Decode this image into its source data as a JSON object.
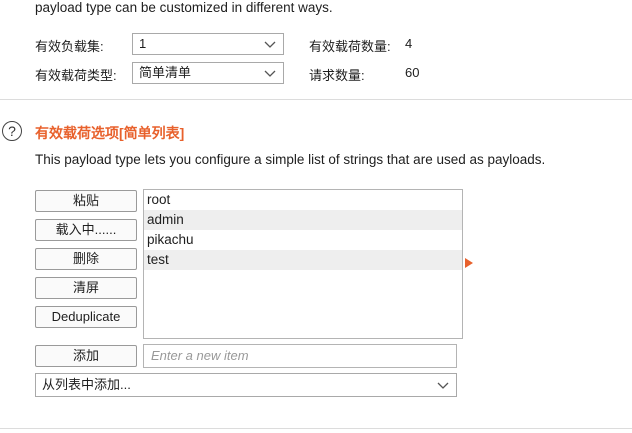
{
  "intro_text": "payload type can be customized in different ways.",
  "payload_sets": {
    "payload_set_label": "有效负载集:",
    "payload_set_value": "1",
    "payload_count_label": "有效载荷数量:",
    "payload_count_value": "4",
    "payload_type_label": "有效载荷类型:",
    "payload_type_value": "简单清单",
    "request_count_label": "请求数量:",
    "request_count_value": "60"
  },
  "options": {
    "help_glyph": "?",
    "title": "有效载荷选项[简单列表]",
    "description": "This payload type lets you configure a simple list of strings that are used as payloads.",
    "buttons": {
      "paste": "粘贴",
      "load": "载入中......",
      "remove": "删除",
      "clear": "清屏",
      "deduplicate": "Deduplicate",
      "add": "添加"
    },
    "items": [
      "root",
      "admin",
      "pikachu",
      "test"
    ],
    "add_placeholder": "Enter a new item",
    "add_from_list": "从列表中添加..."
  },
  "colors": {
    "accent": "#e8612c"
  },
  "icons": {
    "dropdown": "chevron-down-icon",
    "help": "help-icon",
    "pointer": "triangle-right-icon"
  }
}
